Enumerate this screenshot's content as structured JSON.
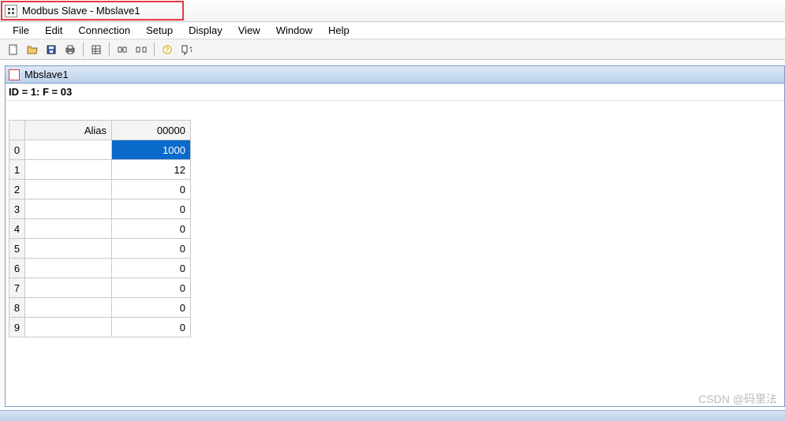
{
  "window": {
    "title": "Modbus Slave - Mbslave1"
  },
  "menu": {
    "file": "File",
    "edit": "Edit",
    "connection": "Connection",
    "setup": "Setup",
    "display": "Display",
    "view": "View",
    "window": "Window",
    "help": "Help"
  },
  "toolbar_icons": {
    "new": "new-file-icon",
    "open": "open-folder-icon",
    "save": "save-disk-icon",
    "print": "printer-icon",
    "table": "table-icon",
    "conn1": "connection-icon",
    "conn2": "disconnect-icon",
    "help": "help-icon",
    "whatsthis": "whats-this-icon"
  },
  "child": {
    "title": "Mbslave1",
    "status": "ID = 1: F = 03"
  },
  "grid": {
    "headers": {
      "rownum": "",
      "alias": "Alias",
      "value": "00000"
    },
    "rows": [
      {
        "idx": "0",
        "alias": "",
        "value": "1000",
        "selected": true
      },
      {
        "idx": "1",
        "alias": "",
        "value": "12",
        "selected": false
      },
      {
        "idx": "2",
        "alias": "",
        "value": "0",
        "selected": false
      },
      {
        "idx": "3",
        "alias": "",
        "value": "0",
        "selected": false
      },
      {
        "idx": "4",
        "alias": "",
        "value": "0",
        "selected": false
      },
      {
        "idx": "5",
        "alias": "",
        "value": "0",
        "selected": false
      },
      {
        "idx": "6",
        "alias": "",
        "value": "0",
        "selected": false
      },
      {
        "idx": "7",
        "alias": "",
        "value": "0",
        "selected": false
      },
      {
        "idx": "8",
        "alias": "",
        "value": "0",
        "selected": false
      },
      {
        "idx": "9",
        "alias": "",
        "value": "0",
        "selected": false
      }
    ]
  },
  "watermark": "CSDN @码里法"
}
